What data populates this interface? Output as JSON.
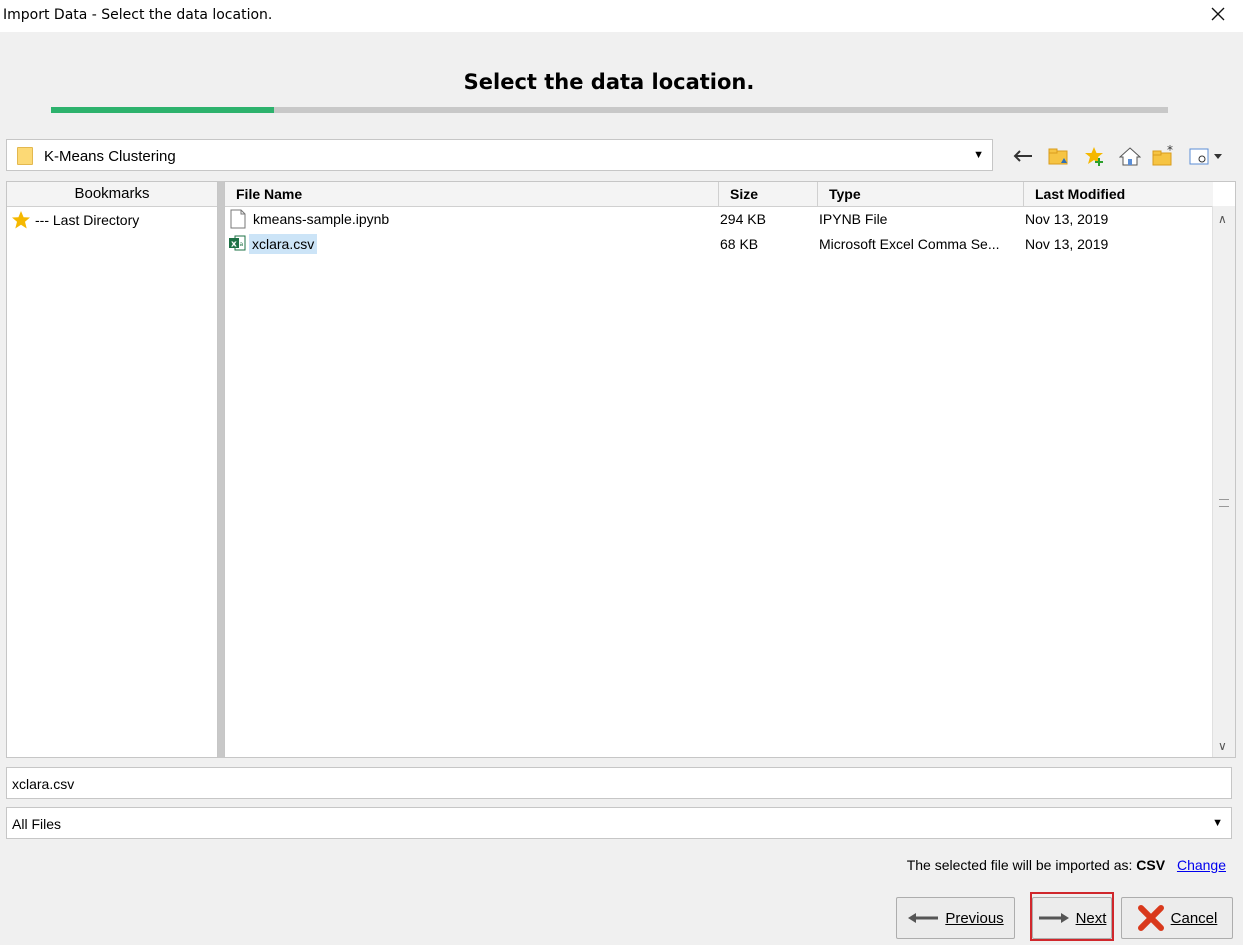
{
  "window": {
    "title": "Import Data - Select the data location."
  },
  "heading": "Select the data location.",
  "progress": {
    "fraction": 0.2
  },
  "location": {
    "folder": "K-Means Clustering"
  },
  "bookmarks": {
    "header": "Bookmarks",
    "items": [
      {
        "label": "--- Last Directory"
      }
    ]
  },
  "files": {
    "columns": [
      "File Name",
      "Size",
      "Type",
      "Last Modified"
    ],
    "rows": [
      {
        "name": "kmeans-sample.ipynb",
        "size": "294 KB",
        "type": "IPYNB File",
        "modified": "Nov 13, 2019",
        "icon": "document-icon"
      },
      {
        "name": "xclara.csv",
        "size": "68 KB",
        "type": "Microsoft Excel Comma Se...",
        "modified": "Nov 13, 2019",
        "icon": "excel-csv-icon",
        "selected": true
      }
    ]
  },
  "filename_field": {
    "value": "xclara.csv"
  },
  "filter": {
    "value": "All Files"
  },
  "import_info": {
    "text": "The selected file will be imported as:",
    "format": "CSV",
    "change_link": "Change"
  },
  "buttons": {
    "previous": "Previous",
    "next": "Next",
    "cancel": "Cancel"
  },
  "colors": {
    "progress": "#2db26d",
    "selection": "#cce4f7",
    "highlight_border": "#d0272c",
    "link": "#0000ee"
  }
}
